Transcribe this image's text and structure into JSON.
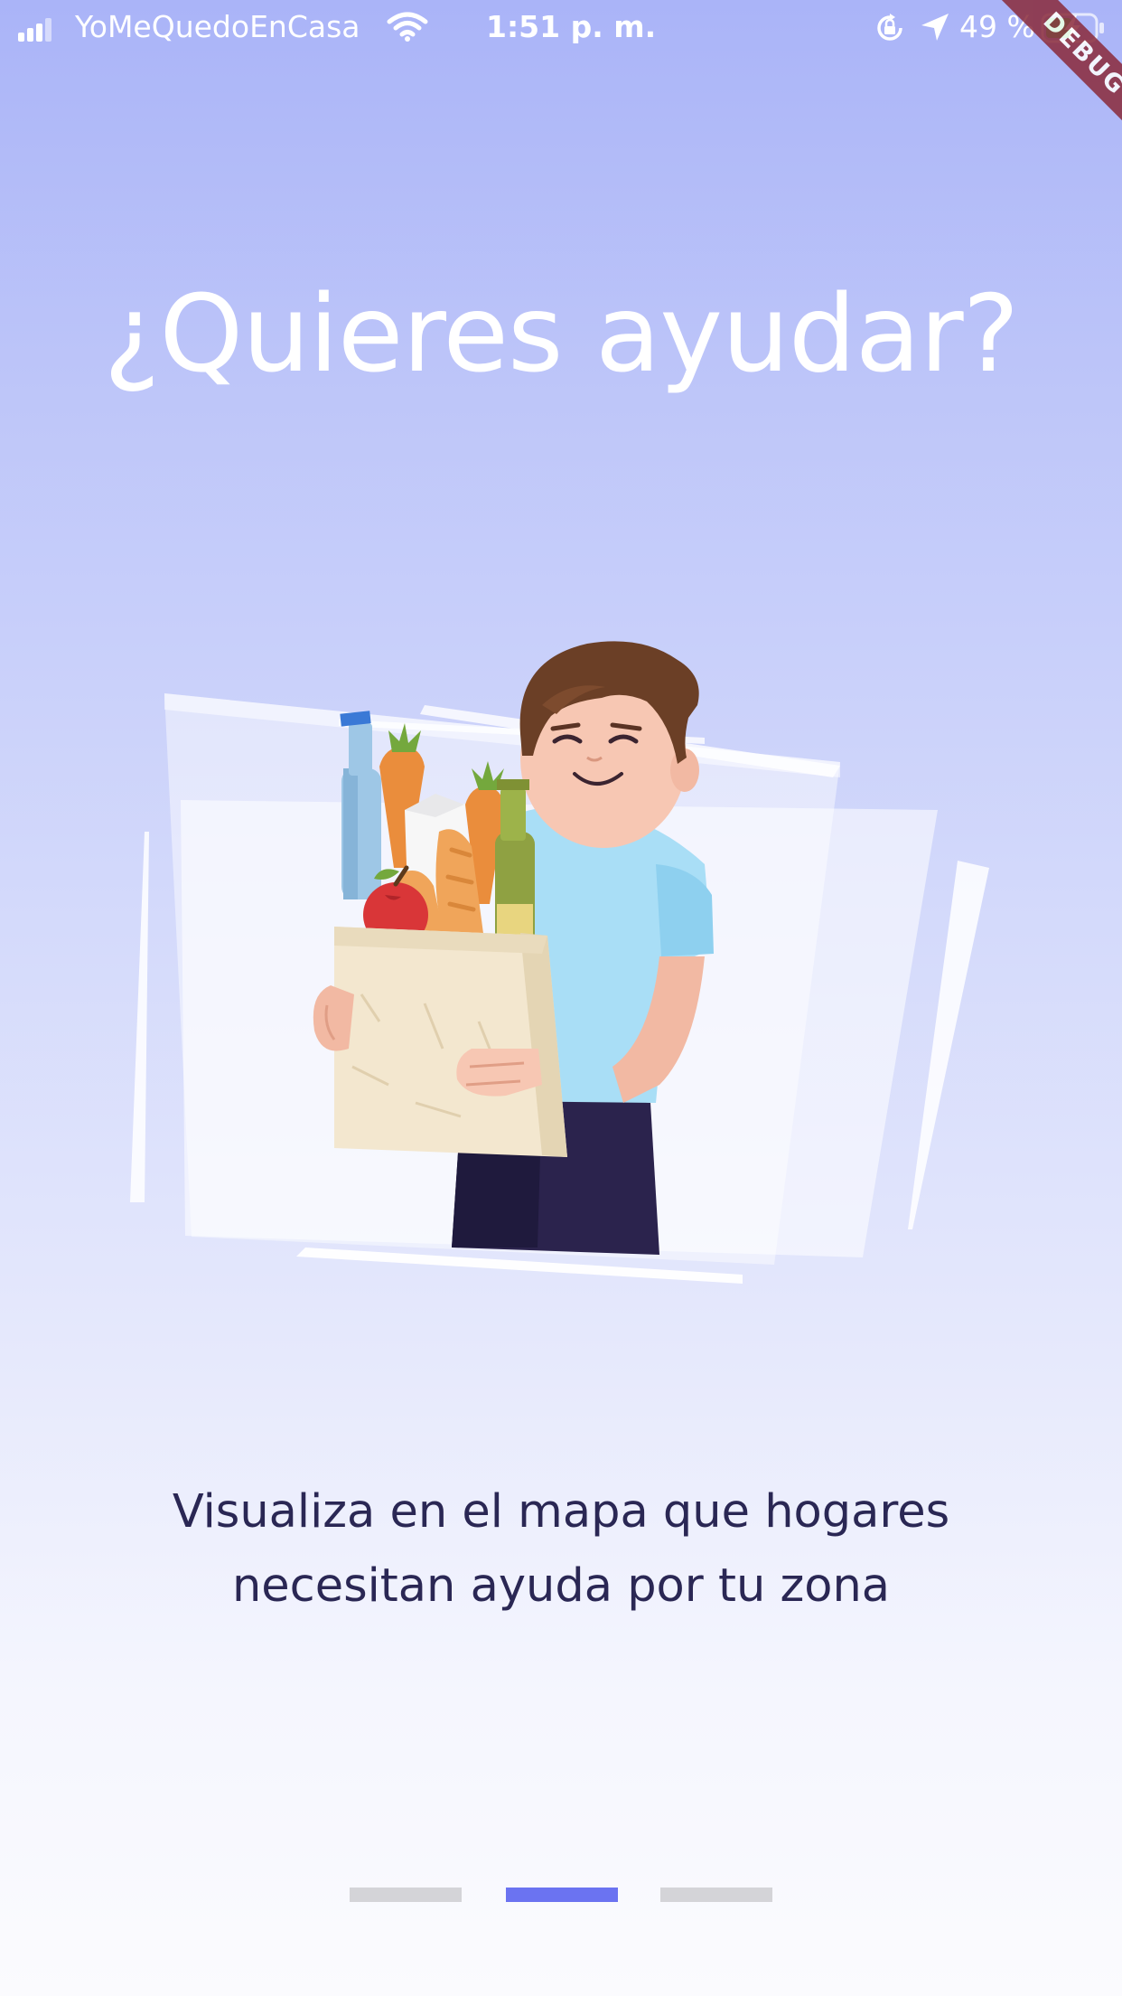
{
  "status_bar": {
    "carrier": "YoMeQuedoEnCasa",
    "time": "1:51 p. m.",
    "battery": "49 %",
    "icons": [
      "signal-icon",
      "wifi-icon",
      "orientation-lock-icon",
      "location-arrow-icon",
      "battery-charging-icon"
    ]
  },
  "debug_banner": "DEBUG",
  "onboarding": {
    "title": "¿Quieres ayudar?",
    "illustration": "person-carrying-groceries-illustration",
    "description_line1": "Visualiza en el mapa que hogares",
    "description_line2": "necesitan ayuda por tu zona",
    "pager": {
      "total": 3,
      "active_index": 1
    }
  },
  "colors": {
    "gradient_top": "#aab4f8",
    "gradient_bottom": "#fbfbfe",
    "title": "#ffffff",
    "description": "#2a2754",
    "pager_active": "#6b73f1",
    "pager_inactive": "#d4d4d8",
    "debug_banner": "#8a2a3a"
  }
}
